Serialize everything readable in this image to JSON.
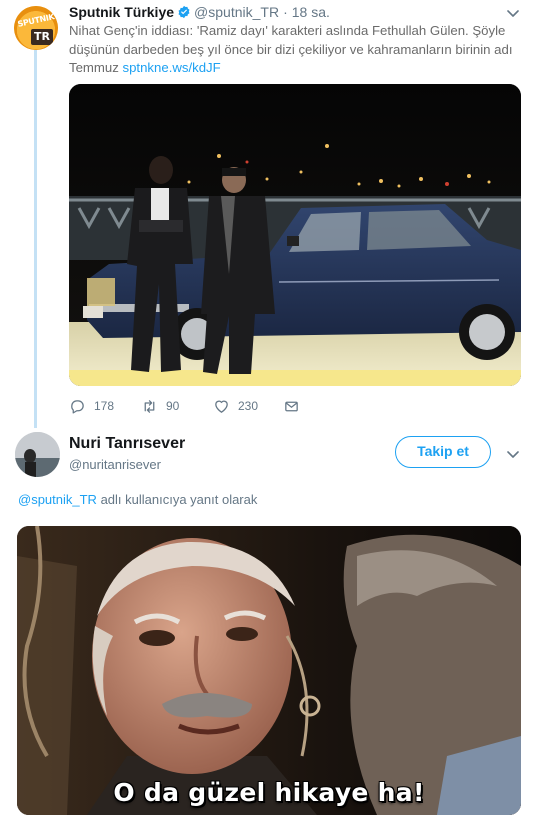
{
  "parent_tweet": {
    "avatar": {
      "brand_text": "SPUTNIK",
      "badge_text": "TR"
    },
    "name": "Sputnik Türkiye",
    "handle": "@sputnik_TR",
    "separator": "·",
    "time": "18 sa.",
    "text_line1": "Nihat Genç'in iddiası: 'Ramiz dayı' karakteri aslında Fethullah Gülen. Şöyle",
    "text_line2": "düşünün darbeden beş yıl önce bir dizi çekiliyor ve kahramanların birinin adı",
    "text_line3": "Temmuz ",
    "link": "sptnkne.ws/kdJF",
    "counts": {
      "replies": "178",
      "retweets": "90",
      "likes": "230"
    },
    "icons": [
      "verified-badge-icon",
      "chevron-down-icon",
      "reply-icon",
      "retweet-icon",
      "heart-icon",
      "envelope-icon"
    ]
  },
  "reply_tweet": {
    "name": "Nuri Tanrısever",
    "handle": "@nuritanrisever",
    "follow_label": "Takip et",
    "reply_mention": "@sputnik_TR",
    "reply_suffix": " adlı kullanıcıya yanıt olarak",
    "image_subtitle": "O da güzel hikaye ha!"
  },
  "colors": {
    "accent": "#1da1f2",
    "secondary_text": "#657786",
    "thread_line": "#c4e1f5"
  }
}
